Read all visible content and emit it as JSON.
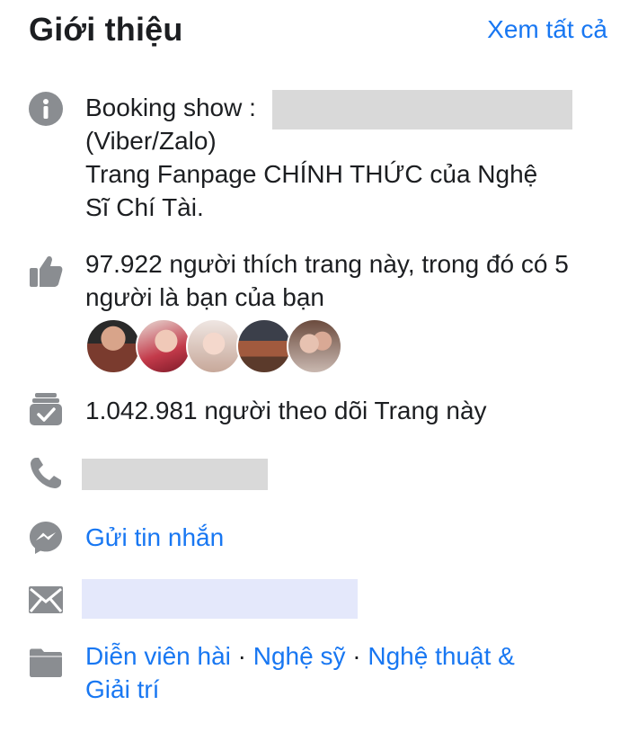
{
  "header": {
    "title": "Giới thiệu",
    "see_all": "Xem tất cả"
  },
  "about": {
    "booking_label": "Booking show :",
    "contact_apps": "(Viber/Zalo)",
    "description_line1": "Trang Fanpage CHÍNH THỨC của Nghệ",
    "description_line2": "Sĩ Chí Tài."
  },
  "likes": {
    "line1": "97.922 người thích trang này, trong đó có 5",
    "line2": "người là bạn của bạn"
  },
  "followers": {
    "text": "1.042.981 người theo dõi Trang này"
  },
  "message": {
    "label": "Gửi tin nhắn"
  },
  "categories": {
    "cat1": "Diễn viên hài",
    "sep1": " · ",
    "cat2": "Nghệ sỹ",
    "sep2": " · ",
    "cat3": "Nghệ thuật &",
    "cat3_cont": "Giải trí"
  },
  "colors": {
    "accent": "#1877f2",
    "icon_gray": "#8a8d91",
    "redaction_gray": "#d9d9d9",
    "redaction_blue": "#e4e8fb"
  },
  "icons": [
    "info-icon",
    "thumbs-up-icon",
    "follow-check-icon",
    "phone-icon",
    "messenger-icon",
    "mail-icon",
    "category-icon"
  ]
}
